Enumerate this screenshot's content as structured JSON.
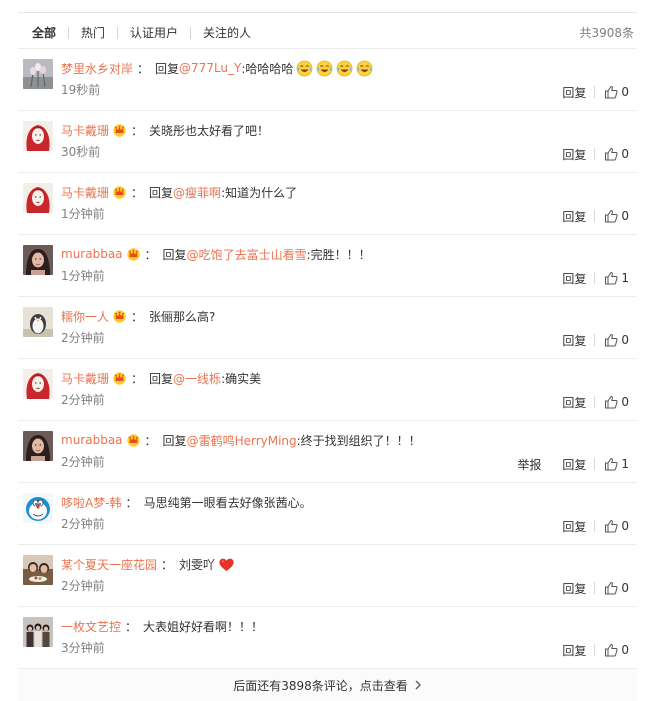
{
  "tabs": [
    {
      "label": "全部",
      "active": true
    },
    {
      "label": "热门",
      "active": false
    },
    {
      "label": "认证用户",
      "active": false
    },
    {
      "label": "关注的人",
      "active": false
    }
  ],
  "total_count": "共3908条",
  "colors": {
    "accent": "#eb7350",
    "text": "#333333",
    "muted": "#808080",
    "divider": "#ececec"
  },
  "comments": [
    {
      "user": "梦里水乡对岸",
      "avatar": "flower-avatar",
      "vip": false,
      "reply_word": "回复",
      "mention": "@777Lu_Y",
      "text": ":哈哈哈哈",
      "emojis": [
        "laughing-tears-emoji",
        "laughing-tears-emoji",
        "laughing-tears-emoji",
        "laughing-tears-emoji"
      ],
      "time": "19秒前",
      "report": "",
      "reply_label": "回复",
      "likes": "0"
    },
    {
      "user": "马卡戴珊",
      "avatar": "redhair-avatar",
      "vip": true,
      "reply_word": "",
      "mention": "",
      "text": "关晓彤也太好看了吧！",
      "emojis": [],
      "time": "30秒前",
      "report": "",
      "reply_label": "回复",
      "likes": "0"
    },
    {
      "user": "马卡戴珊",
      "avatar": "redhair-avatar",
      "vip": true,
      "reply_word": "回复",
      "mention": "@瘦菲啊",
      "text": ":知道为什么了",
      "emojis": [],
      "time": "1分钟前",
      "report": "",
      "reply_label": "回复",
      "likes": "0"
    },
    {
      "user": "murabbaa",
      "avatar": "woman-avatar",
      "vip": true,
      "reply_word": "回复",
      "mention": "@吃饱了去富士山看雪",
      "text": ":完胜！！！",
      "emojis": [],
      "time": "1分钟前",
      "report": "",
      "reply_label": "回复",
      "likes": "1"
    },
    {
      "user": "糯你一人",
      "avatar": "penguin-avatar",
      "vip": true,
      "reply_word": "",
      "mention": "",
      "text": "张俪那么高?",
      "emojis": [],
      "time": "2分钟前",
      "report": "",
      "reply_label": "回复",
      "likes": "0"
    },
    {
      "user": "马卡戴珊",
      "avatar": "redhair-avatar",
      "vip": true,
      "reply_word": "回复",
      "mention": "@一线栎",
      "text": ":确实美",
      "emojis": [],
      "time": "2分钟前",
      "report": "",
      "reply_label": "回复",
      "likes": "0"
    },
    {
      "user": "murabbaa",
      "avatar": "woman-avatar",
      "vip": true,
      "reply_word": "回复",
      "mention": "@雷鹤鸣HerryMing",
      "text": ":终于找到组织了！！！",
      "emojis": [],
      "time": "2分钟前",
      "report": "举报",
      "reply_label": "回复",
      "likes": "1"
    },
    {
      "user": "哆啦A梦-韩",
      "avatar": "doraemon-avatar",
      "vip": false,
      "reply_word": "",
      "mention": "",
      "text": "马思纯第一眼看去好像张茜心。",
      "emojis": [],
      "time": "2分钟前",
      "report": "",
      "reply_label": "回复",
      "likes": "0"
    },
    {
      "user": "某个夏天一座花园",
      "avatar": "food-avatar",
      "vip": false,
      "reply_word": "",
      "mention": "",
      "text": "刘雯吖",
      "emojis": [
        "heart-emoji"
      ],
      "time": "2分钟前",
      "report": "",
      "reply_label": "回复",
      "likes": "0"
    },
    {
      "user": "一枚文艺控",
      "avatar": "group-avatar",
      "vip": false,
      "reply_word": "",
      "mention": "",
      "text": "大表姐好好看啊！！！",
      "emojis": [],
      "time": "3分钟前",
      "report": "",
      "reply_label": "回复",
      "likes": "0"
    }
  ],
  "footer": {
    "label": "后面还有3898条评论，点击查看",
    "icon": "chevron-right-icon"
  }
}
